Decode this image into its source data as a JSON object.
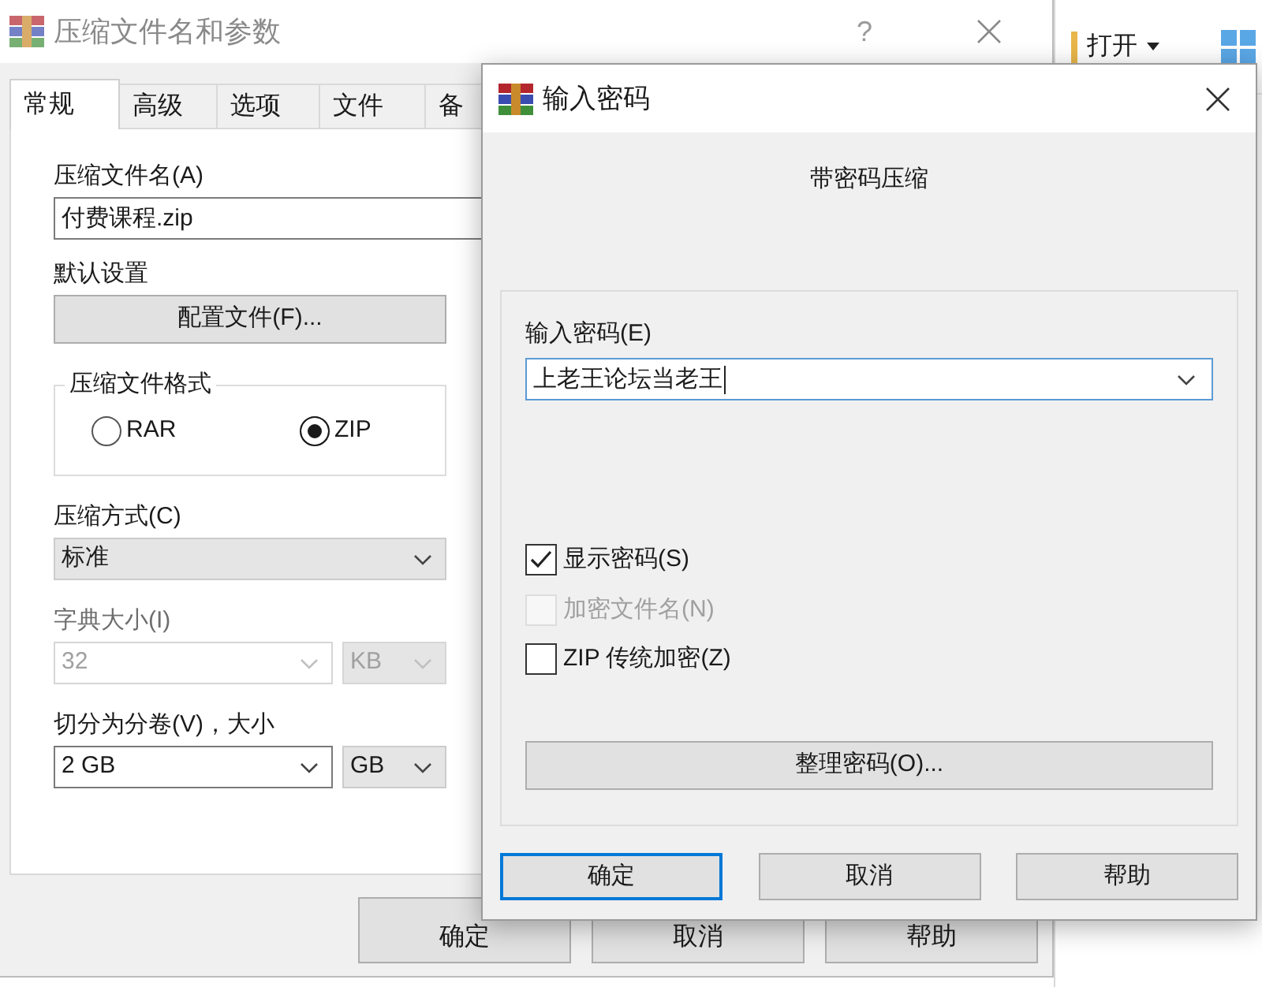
{
  "background_window": {
    "open_button": "打开"
  },
  "archive_window": {
    "title": "压缩文件名和参数",
    "help_button": "?",
    "tabs": [
      {
        "label": "常规",
        "selected": true
      },
      {
        "label": "高级",
        "selected": false
      },
      {
        "label": "选项",
        "selected": false
      },
      {
        "label": "文件",
        "selected": false
      },
      {
        "label": "备",
        "selected": false
      }
    ],
    "archive_name": {
      "label": "压缩文件名(A)",
      "value": "付费课程.zip"
    },
    "defaults": {
      "label": "默认设置",
      "button": "配置文件(F)..."
    },
    "format": {
      "label": "压缩文件格式",
      "options": [
        {
          "label": "RAR",
          "selected": false
        },
        {
          "label": "ZIP",
          "selected": true
        }
      ]
    },
    "method": {
      "label": "压缩方式(C)",
      "value": "标准"
    },
    "dictionary": {
      "label": "字典大小(I)",
      "value": "32",
      "unit": "KB",
      "disabled": true
    },
    "split": {
      "label": "切分为分卷(V)，大小",
      "value": "2 GB",
      "unit": "GB",
      "disabled": false
    },
    "buttons": [
      "确定",
      "取消",
      "帮助"
    ]
  },
  "password_dialog": {
    "title": "输入密码",
    "heading": "带密码压缩",
    "password": {
      "label": "输入密码(E)",
      "value": "上老王论坛当老王"
    },
    "options": [
      {
        "label": "显示密码(S)",
        "checked": true,
        "disabled": false
      },
      {
        "label": "加密文件名(N)",
        "checked": false,
        "disabled": true
      },
      {
        "label": "ZIP 传统加密(Z)",
        "checked": false,
        "disabled": false
      }
    ],
    "organize_button": "整理密码(O)...",
    "buttons": [
      {
        "label": "确定",
        "default": true
      },
      {
        "label": "取消",
        "default": false
      },
      {
        "label": "帮助",
        "default": false
      }
    ]
  }
}
